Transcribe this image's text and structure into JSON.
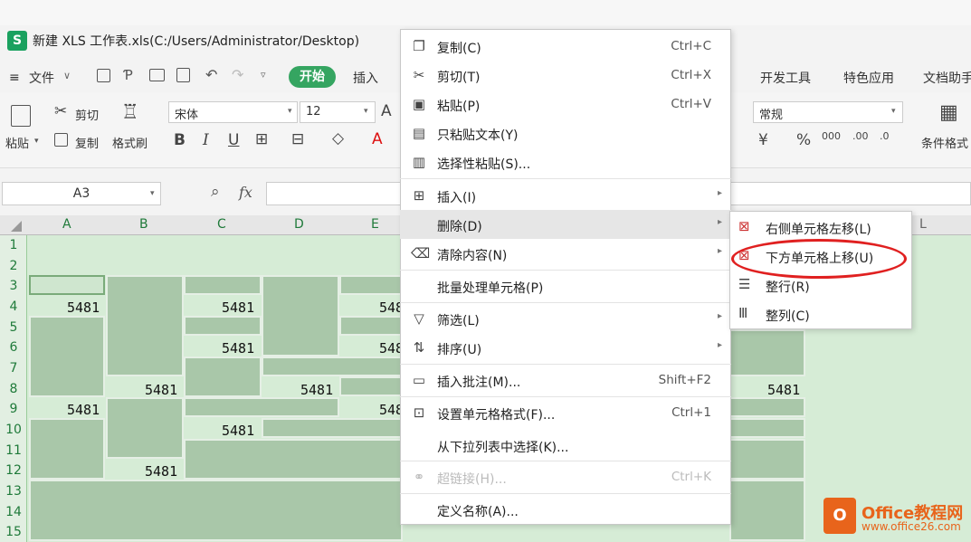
{
  "app": {
    "logo": "S",
    "title": "新建 XLS 工作表.xls(C:/Users/Administrator/Desktop)"
  },
  "menubar": {
    "file": "文件",
    "tabs": [
      "开始",
      "插入",
      "开发工具",
      "特色应用",
      "文档助手"
    ]
  },
  "ribbon": {
    "paste": "粘贴",
    "cut": "剪切",
    "copy": "复制",
    "format_painter": "格式刷",
    "font": "宋体",
    "size": "12",
    "number_format": "常规",
    "conditional_format": "条件格式"
  },
  "formula_bar": {
    "cell_ref": "A3",
    "fx": "fx"
  },
  "grid": {
    "columns": [
      "A",
      "B",
      "C",
      "D",
      "E",
      "L"
    ],
    "rows": [
      "1",
      "2",
      "3",
      "4",
      "5",
      "6",
      "7",
      "8",
      "9",
      "10",
      "11",
      "12",
      "13",
      "14",
      "15"
    ],
    "value": "5481"
  },
  "context_menu": {
    "items": [
      {
        "label": "复制(C)",
        "shortcut": "Ctrl+C",
        "icon": "copy-icon"
      },
      {
        "label": "剪切(T)",
        "shortcut": "Ctrl+X",
        "icon": "scissors-icon"
      },
      {
        "label": "粘贴(P)",
        "shortcut": "Ctrl+V",
        "icon": "paste-icon"
      },
      {
        "label": "只粘贴文本(Y)",
        "shortcut": "",
        "icon": "paste-text-icon"
      },
      {
        "label": "选择性粘贴(S)...",
        "shortcut": "",
        "icon": "paste-special-icon"
      },
      {
        "label": "插入(I)",
        "shortcut": "",
        "icon": "insert-icon"
      },
      {
        "label": "删除(D)",
        "shortcut": "",
        "icon": ""
      },
      {
        "label": "清除内容(N)",
        "shortcut": "",
        "icon": "eraser-icon"
      },
      {
        "label": "批量处理单元格(P)",
        "shortcut": "",
        "icon": ""
      },
      {
        "label": "筛选(L)",
        "shortcut": "",
        "icon": "filter-icon"
      },
      {
        "label": "排序(U)",
        "shortcut": "",
        "icon": "sort-icon"
      },
      {
        "label": "插入批注(M)...",
        "shortcut": "Shift+F2",
        "icon": "comment-icon"
      },
      {
        "label": "设置单元格格式(F)...",
        "shortcut": "Ctrl+1",
        "icon": "format-cells-icon"
      },
      {
        "label": "从下拉列表中选择(K)...",
        "shortcut": "",
        "icon": ""
      },
      {
        "label": "超链接(H)...",
        "shortcut": "Ctrl+K",
        "icon": "link-icon"
      },
      {
        "label": "定义名称(A)...",
        "shortcut": "",
        "icon": ""
      }
    ]
  },
  "submenu": {
    "items": [
      {
        "label": "右侧单元格左移(L)",
        "icon": "shift-left-icon"
      },
      {
        "label": "下方单元格上移(U)",
        "icon": "shift-up-icon"
      },
      {
        "label": "整行(R)",
        "icon": "row-icon"
      },
      {
        "label": "整列(C)",
        "icon": "column-icon"
      }
    ]
  },
  "watermark": {
    "name": "Office教程网",
    "url": "www.office26.com"
  },
  "colors": {
    "accent": "#35a561",
    "highlight_circle": "#e02020",
    "grid_selected": "#d6ecd6",
    "watermark": "#e8641b"
  }
}
